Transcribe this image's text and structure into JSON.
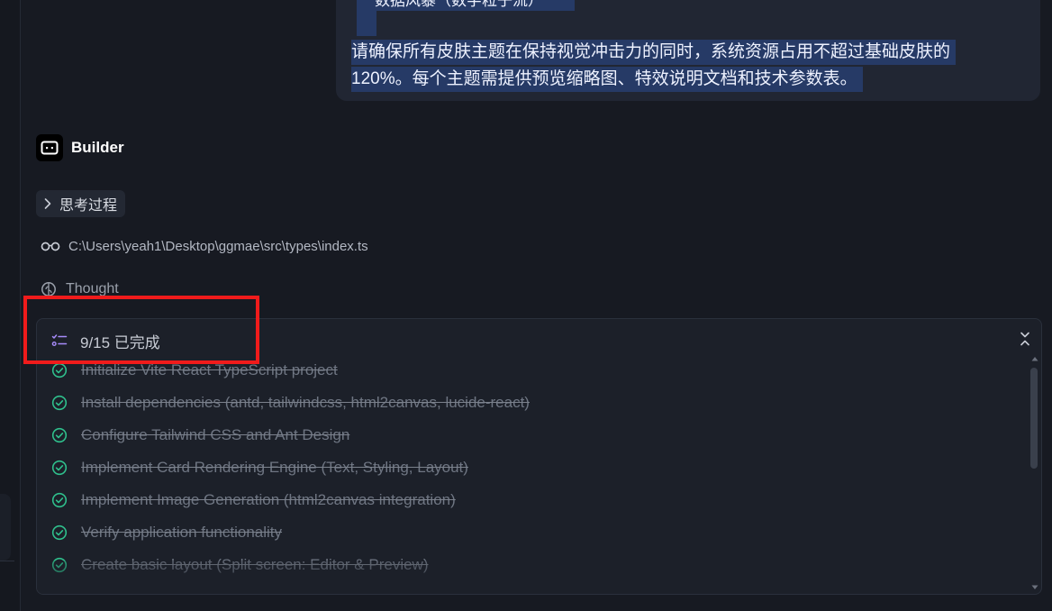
{
  "user_message": {
    "line_top": "数据风暴（数字粒子流）",
    "line1": "请确保所有皮肤主题在保持视觉冲击力的同时，系统资源占用不超过基础皮肤的",
    "line2": "120%。每个主题需提供预览缩略图、特效说明文档和技术参数表。"
  },
  "builder": {
    "icon": "bot-face-icon",
    "title": "Builder"
  },
  "thinking": {
    "icon": "chevron-right-icon",
    "label": "思考过程"
  },
  "file_read": {
    "icon": "glasses-icon",
    "path": "C:\\Users\\yeah1\\Desktop\\ggmae\\src\\types\\index.ts"
  },
  "thought": {
    "icon": "thought-icon",
    "label": "Thought"
  },
  "todo": {
    "icon": "checklist-icon",
    "summary": "9/15 已完成",
    "collapse_icon": "collapse-icon",
    "items": [
      {
        "label": "Initialize Vite React TypeScript project",
        "done": true
      },
      {
        "label": "Install dependencies (antd, tailwindcss, html2canvas, lucide-react)",
        "done": true
      },
      {
        "label": "Configure Tailwind CSS and Ant Design",
        "done": true
      },
      {
        "label": "Implement Card Rendering Engine (Text, Styling, Layout)",
        "done": true
      },
      {
        "label": "Implement Image Generation (html2canvas integration)",
        "done": true
      },
      {
        "label": "Verify application functionality",
        "done": true
      },
      {
        "label": "Create basic layout (Split screen: Editor & Preview)",
        "done": true
      }
    ]
  },
  "colors": {
    "background": "#171a22",
    "check_green": "#2fbf8c",
    "selection": "#263a66",
    "annotation_red": "#f01b1b"
  }
}
